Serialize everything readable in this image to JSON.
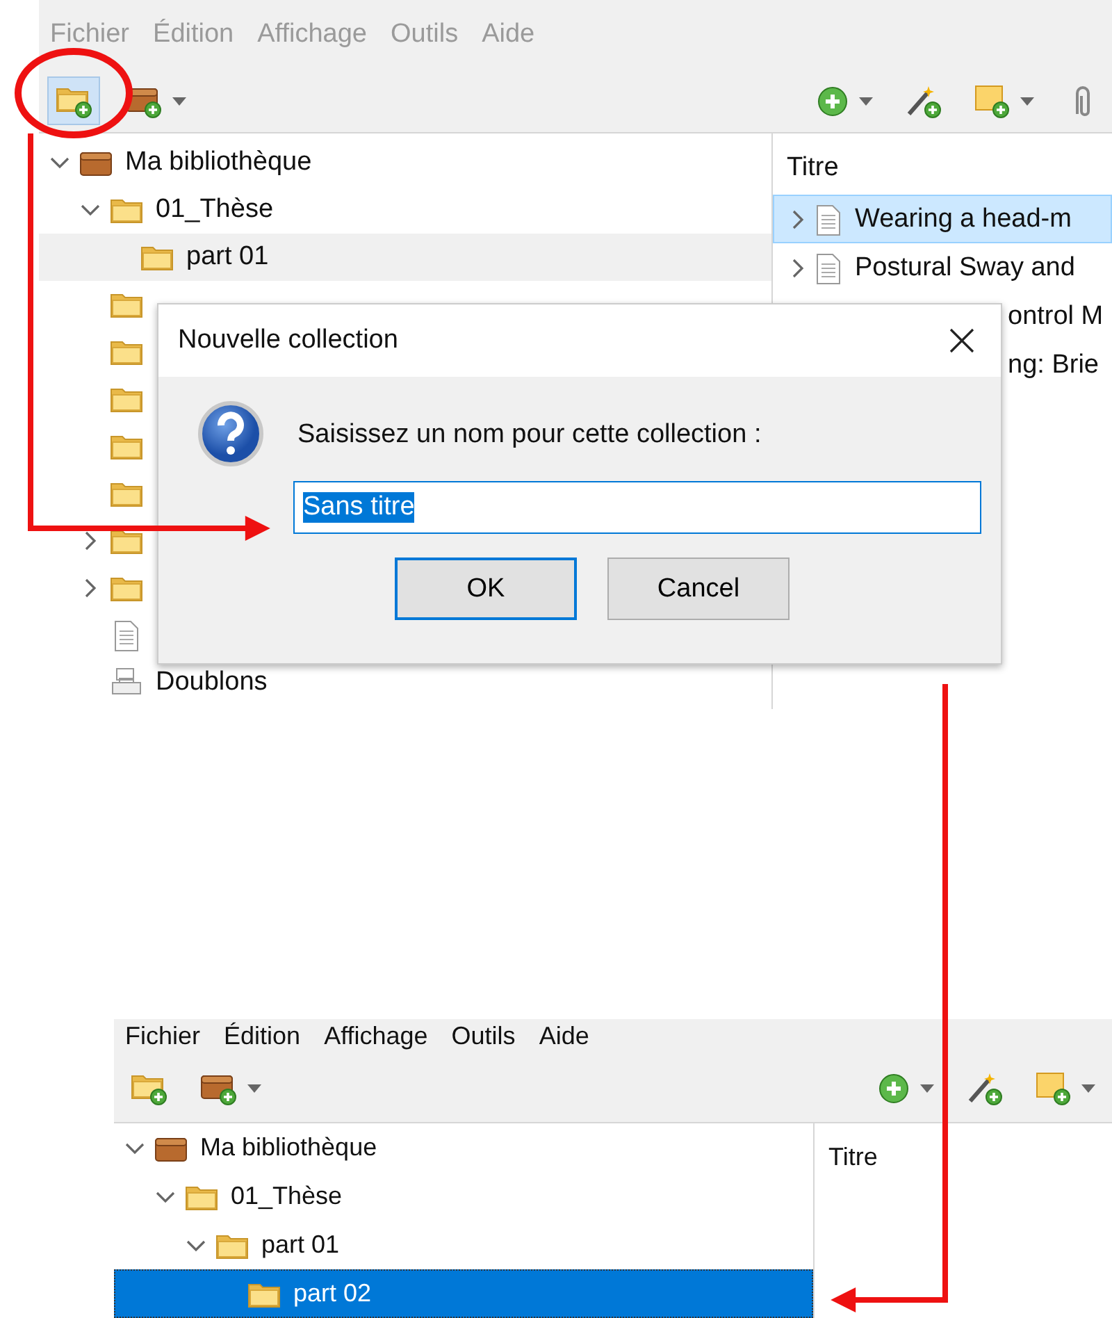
{
  "screens": [
    {
      "menu": [
        {
          "label": "Fichier"
        },
        {
          "label": "Édition"
        },
        {
          "label": "Affichage"
        },
        {
          "label": "Outils"
        },
        {
          "label": "Aide"
        }
      ],
      "menu_disabled": true,
      "toolbar": [
        {
          "kind": "new-collection",
          "pressed": true
        },
        {
          "kind": "new-library",
          "dropdown": true
        },
        {
          "kind": "spacer"
        },
        {
          "kind": "new-item",
          "dropdown": true
        },
        {
          "kind": "wand"
        },
        {
          "kind": "new-note",
          "dropdown": true
        },
        {
          "kind": "attachment"
        }
      ],
      "tree_focused": false,
      "tree": [
        {
          "kind": "library",
          "label": "Ma bibliothèque",
          "expanded": true,
          "selected": false,
          "children": [
            {
              "kind": "folder",
              "label": "01_Thèse",
              "expanded": true,
              "selected": false,
              "children": [
                {
                  "kind": "folder",
                  "label": "part 01",
                  "selected": true
                }
              ]
            },
            {
              "kind": "folder",
              "selected": false
            },
            {
              "kind": "folder",
              "selected": false
            },
            {
              "kind": "folder",
              "selected": false
            },
            {
              "kind": "folder",
              "selected": false
            },
            {
              "kind": "folder",
              "selected": false
            },
            {
              "kind": "folder",
              "expanded": false,
              "selected": false
            },
            {
              "kind": "folder",
              "expanded": false,
              "selected": false
            },
            {
              "kind": "document",
              "selected": false
            },
            {
              "kind": "duplicates",
              "label": "Doublons",
              "selected": false
            }
          ]
        }
      ],
      "items": {
        "column": "Titre",
        "rows": [
          {
            "title": "Wearing a head-m",
            "kind": "full",
            "selected": true
          },
          {
            "title": "Postural Sway and",
            "kind": "full",
            "selected": false
          },
          {
            "title": "ontrol M",
            "kind": "partial",
            "selected": false
          },
          {
            "title": "ng: Brie",
            "kind": "partial",
            "selected": false
          }
        ]
      },
      "dialog": {
        "title": "Nouvelle collection",
        "prompt": "Saisissez un nom pour cette collection :",
        "value": "Sans titre",
        "value_selected": true,
        "buttons": [
          {
            "label": "OK",
            "default": true
          },
          {
            "label": "Cancel",
            "default": false
          }
        ]
      }
    },
    {
      "menu": [
        {
          "label": "Fichier"
        },
        {
          "label": "Édition"
        },
        {
          "label": "Affichage"
        },
        {
          "label": "Outils"
        },
        {
          "label": "Aide"
        }
      ],
      "menu_disabled": false,
      "toolbar": [
        {
          "kind": "new-collection",
          "pressed": false
        },
        {
          "kind": "new-library",
          "dropdown": true
        },
        {
          "kind": "spacer"
        },
        {
          "kind": "new-item",
          "dropdown": true
        },
        {
          "kind": "wand"
        },
        {
          "kind": "new-note",
          "dropdown": true
        }
      ],
      "tree_focused": true,
      "tree": [
        {
          "kind": "library",
          "label": "Ma bibliothèque",
          "expanded": true,
          "selected": false,
          "children": [
            {
              "kind": "folder",
              "label": "01_Thèse",
              "expanded": true,
              "selected": false,
              "children": [
                {
                  "kind": "folder",
                  "label": "part 01",
                  "expanded": true,
                  "selected": false,
                  "children": [
                    {
                      "kind": "folder",
                      "label": "part 02",
                      "selected": true
                    }
                  ]
                }
              ]
            }
          ]
        }
      ],
      "items": {
        "column": "Titre"
      }
    }
  ]
}
